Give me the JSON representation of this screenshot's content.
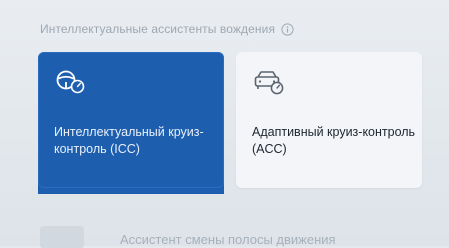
{
  "section": {
    "title": "Интеллектуальные ассистенты вождения",
    "info_icon": "info-icon"
  },
  "cards": [
    {
      "id": "icc",
      "label": "Интеллектуальный круиз-контроль (ICC)",
      "selected": true,
      "icon": "steering-wheel-speedometer-icon"
    },
    {
      "id": "acc",
      "label": "Адаптивный круиз-контроль (ACC)",
      "selected": false,
      "icon": "car-speedometer-icon"
    }
  ],
  "lane_assist": {
    "label": "Ассистент смены полосы движения",
    "enabled": false
  },
  "colors": {
    "selected_card": "#1d5eaf",
    "unselected_card": "#f3f5f8",
    "muted_text": "#9ea7b1"
  }
}
